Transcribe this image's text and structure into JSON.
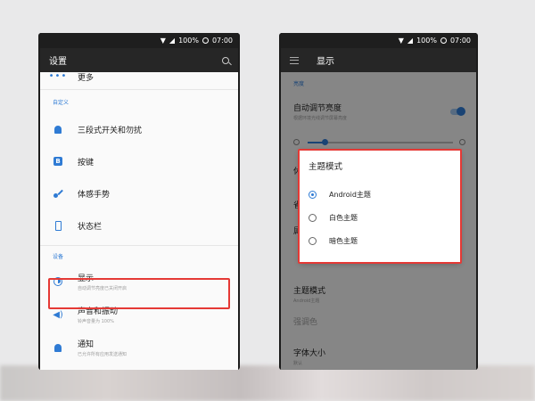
{
  "status": {
    "battery": "100%",
    "time": "07:00"
  },
  "left": {
    "title": "设置",
    "items_top": [
      {
        "label": "更多"
      }
    ],
    "section_custom": "自定义",
    "custom_items": [
      {
        "label": "三段式开关和勿扰"
      },
      {
        "label": "按键"
      },
      {
        "label": "体感手势"
      },
      {
        "label": "状态栏"
      }
    ],
    "section_device": "设备",
    "display_item": {
      "label": "显示",
      "sub": "自动调节亮度已关闭开启"
    },
    "sound_item": {
      "label": "声音和振动",
      "sub": "铃声音量为 100%"
    },
    "notify_item": {
      "label": "通知",
      "sub": "已允许所有应用发送通知"
    }
  },
  "right": {
    "title": "显示",
    "section_brightness": "亮度",
    "auto_brightness": {
      "label": "自动调节亮度",
      "sub": "根据环境光线调节屏幕亮度"
    },
    "brightness_value": 0.12,
    "dialog": {
      "title": "主题模式",
      "options": [
        {
          "label": "Android主题",
          "selected": true
        },
        {
          "label": "白色主题",
          "selected": false
        },
        {
          "label": "暗色主题",
          "selected": false
        }
      ]
    },
    "behind_partials": [
      "休",
      "省",
      "属"
    ],
    "theme_mode": {
      "label": "主题模式",
      "sub": "Android主题"
    },
    "accent": {
      "label": "强调色"
    },
    "font_size": {
      "label": "字体大小",
      "sub": "默认"
    }
  },
  "colors": {
    "accent": "#2f7bd4",
    "highlight": "#e53935"
  }
}
